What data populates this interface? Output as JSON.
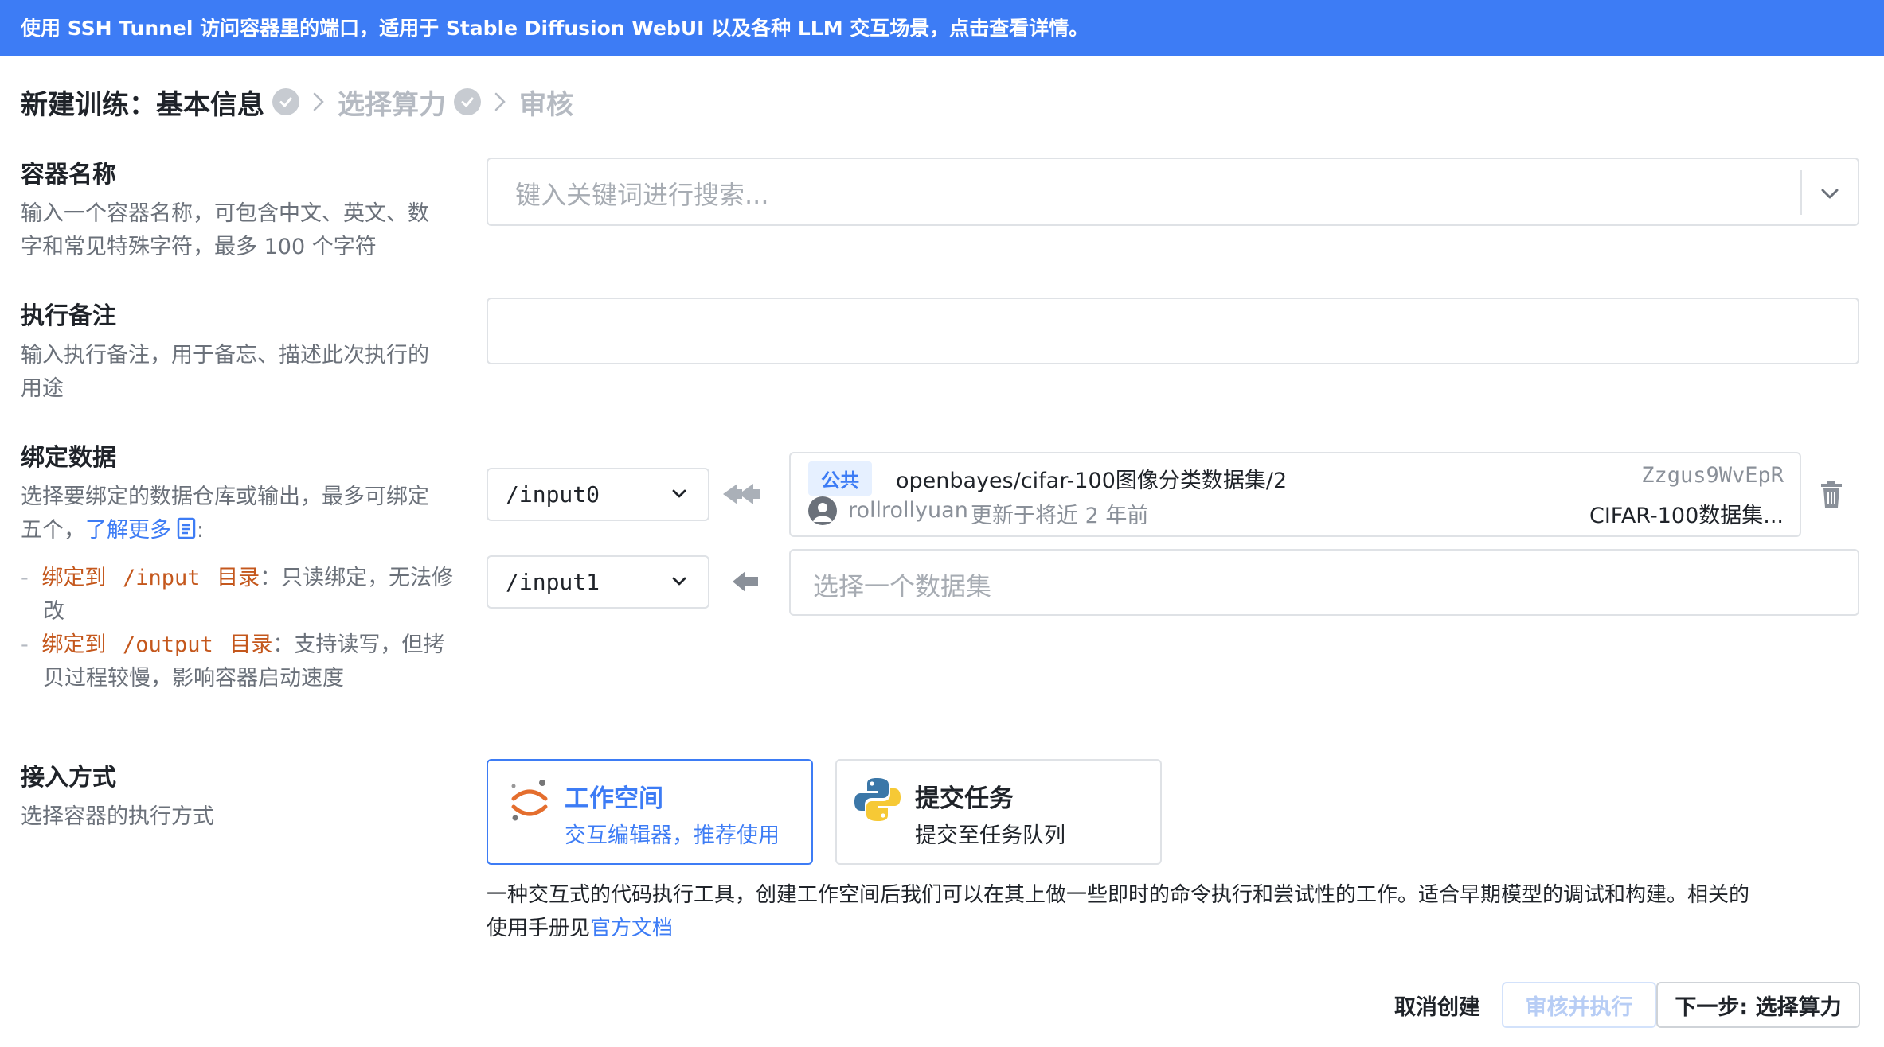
{
  "banner": {
    "text": "使用 SSH Tunnel 访问容器里的端口，适用于 Stable Diffusion WebUI 以及各种 LLM 交互场景，点击查看详情。"
  },
  "steps": {
    "prefix": "新建训练：",
    "items": [
      {
        "label": "基本信息",
        "state": "active",
        "completed": true
      },
      {
        "label": "选择算力",
        "state": "inactive",
        "completed": true
      },
      {
        "label": "审核",
        "state": "inactive",
        "completed": false
      }
    ]
  },
  "container_name": {
    "title": "容器名称",
    "desc_line1": "输入一个容器名称，可包含中文、英文、数",
    "desc_line2": "字和常见特殊字符，最多 100 个字符",
    "placeholder": "键入关键词进行搜索..."
  },
  "note": {
    "title": "执行备注",
    "desc_line1": "输入执行备注，用于备忘、描述此次执行的",
    "desc_line2": "用途",
    "value": ""
  },
  "bind_data": {
    "title": "绑定数据",
    "desc_line1": "选择要绑定的数据仓库或输出，最多可绑定",
    "desc_line2_prefix": "五个，",
    "learn_more": "了解更多",
    "desc_line2_suffix": ":",
    "bullet1": {
      "dash": "-",
      "label": "绑定到",
      "path": "/input",
      "dir": "目录",
      "text1": "：只读绑定，无法修",
      "text2": "改"
    },
    "bullet2": {
      "dash": "-",
      "label": "绑定到",
      "path": "/output",
      "dir": "目录",
      "text1": "：支持读写，但拷",
      "text2": "贝过程较慢，影响容器启动速度"
    },
    "rows": [
      {
        "mount": "/input0",
        "dataset": {
          "tag": "公共",
          "name": "openbayes/cifar-100图像分类数据集/2",
          "id": "Zzgus9WvEpR",
          "user": "rollrollyuan",
          "updated": "更新于将近 2 年前",
          "short": "CIFAR-100数据集..."
        }
      },
      {
        "mount": "/input1",
        "placeholder": "选择一个数据集"
      }
    ]
  },
  "access": {
    "title": "接入方式",
    "desc": "选择容器的执行方式",
    "options": [
      {
        "title": "工作空间",
        "subtitle": "交互编辑器，推荐使用",
        "icon": "jupyter-icon",
        "selected": true
      },
      {
        "title": "提交任务",
        "subtitle": "提交至任务队列",
        "icon": "python-icon",
        "selected": false
      }
    ],
    "explain_line1": "一种交互式的代码执行工具，创建工作空间后我们可以在其上做一些即时的命令执行和尝试性的工作。适合早期模型的调试和构建。相关的",
    "explain_line2_prefix": "使用手册见",
    "explain_link": "官方文档"
  },
  "footer": {
    "cancel": "取消创建",
    "review_run": "审核并执行",
    "next": "下一步: 选择算力"
  },
  "colors": {
    "primary": "#3d7cf5",
    "banner_bg": "#3d7cf5",
    "border": "#dfe2e6",
    "muted": "#6b717a",
    "orange": "#c4571c"
  }
}
